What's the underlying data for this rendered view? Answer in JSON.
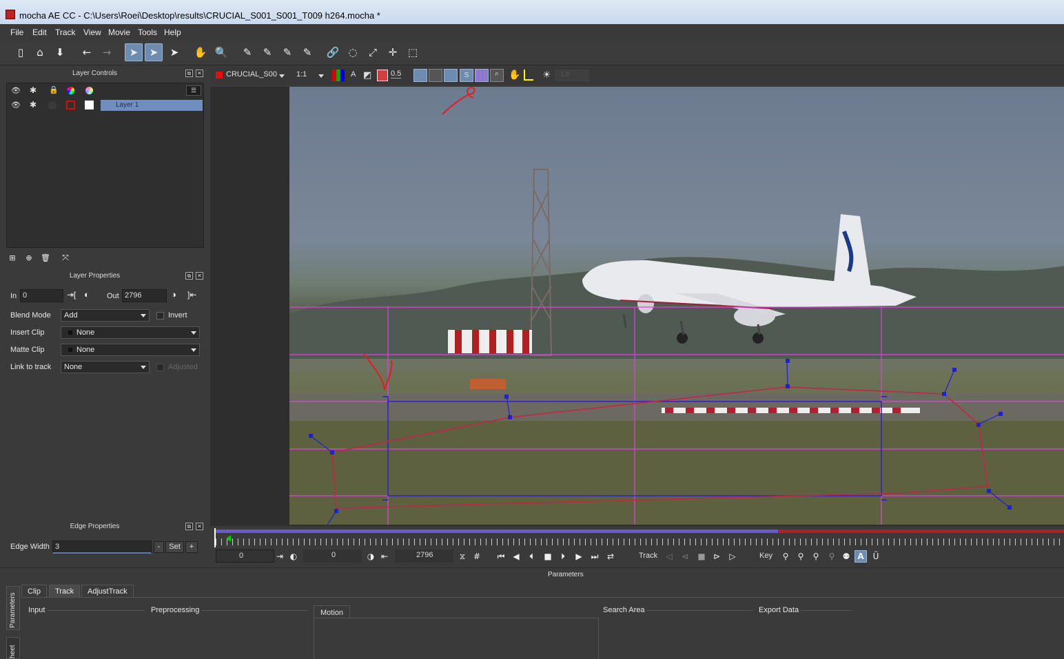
{
  "window": {
    "title": "mocha AE CC - C:\\Users\\Roei\\Desktop\\results\\CRUCIAL_S001_S001_T009 h264.mocha *"
  },
  "menu": [
    "File",
    "Edit",
    "Track",
    "View",
    "Movie",
    "Tools",
    "Help"
  ],
  "layer_controls": {
    "title": "Layer Controls",
    "layers": [
      {
        "name": "Layer 1"
      }
    ]
  },
  "layer_properties": {
    "title": "Layer Properties",
    "in_label": "In",
    "in_value": "0",
    "out_label": "Out",
    "out_value": "2796",
    "blend_mode_label": "Blend Mode",
    "blend_mode_value": "Add",
    "invert_label": "Invert",
    "insert_clip_label": "Insert Clip",
    "insert_clip_value": "None",
    "matte_clip_label": "Matte Clip",
    "matte_clip_value": "None",
    "link_to_track_label": "Link to track",
    "link_to_track_value": "None",
    "adjusted_label": "Adjusted"
  },
  "edge_properties": {
    "title": "Edge Properties",
    "edge_width_label": "Edge Width",
    "edge_width_value": "3",
    "minus_label": "-",
    "set_label": "Set",
    "plus_label": "+"
  },
  "viewer_toolbar": {
    "clip_name": "CRUCIAL_S00",
    "zoom": "1:1",
    "channel_label": "A",
    "opacity": "0.5",
    "brightness": "1.0"
  },
  "timeline": {
    "current_frame": "0",
    "in_frame": "0",
    "out_frame": "2796",
    "track_label": "Track",
    "key_label": "Key"
  },
  "parameters": {
    "title": "Parameters",
    "side_tab": "Parameters",
    "side_tab2": "heet",
    "tabs": [
      "Clip",
      "Track",
      "AdjustTrack"
    ],
    "sections": {
      "input": "Input",
      "preprocessing": "Preprocessing",
      "motion": "Motion",
      "search_area": "Search Area",
      "export_data": "Export Data"
    }
  },
  "colors": {
    "accent_blue": "#6e8bb0",
    "layer_select": "#6f8fbf",
    "guide_magenta": "#e040e0",
    "spline_red": "#c0264a",
    "track_blue": "#2020d0",
    "timeline_blue": "#6a5acd",
    "timeline_red": "#b0202a"
  }
}
